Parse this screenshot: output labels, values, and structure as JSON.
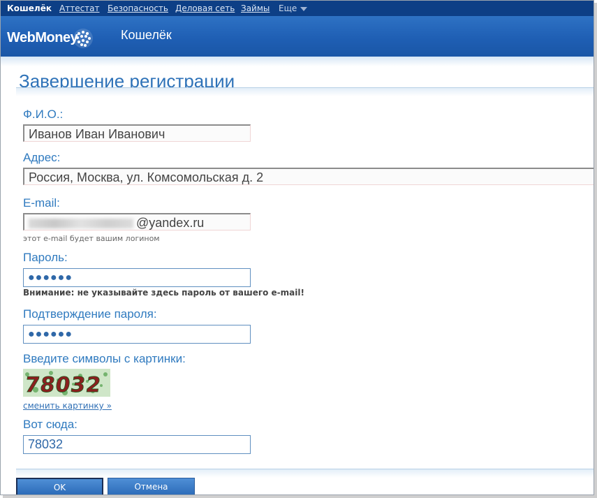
{
  "topnav": {
    "items": [
      "Кошелёк",
      "Аттестат",
      "Безопасность",
      "Деловая сеть",
      "Займы"
    ],
    "more_label": "Еще"
  },
  "header": {
    "logo_text": "WebMoney",
    "title": "Кошелёк"
  },
  "page": {
    "title": "Завершение регистрации"
  },
  "form": {
    "fio": {
      "label": "Ф.И.О.:",
      "value": "Иванов Иван Иванович"
    },
    "address": {
      "label": "Адрес:",
      "value": "Россия, Москва, ул. Комсомольская д. 2"
    },
    "email": {
      "label": "E-mail:",
      "value_suffix": "@yandex.ru",
      "hint": "этот e-mail будет вашим логином"
    },
    "password": {
      "label": "Пароль:",
      "value": "●●●●●●",
      "warning": "Внимание: не указывайте здесь пароль от вашего e-mail!"
    },
    "password_confirm": {
      "label": "Подтверждение пароля:",
      "value": "●●●●●●"
    },
    "captcha": {
      "label": "Введите символы с картинки:",
      "image_text": "78032",
      "change_link": "сменить картинку »"
    },
    "captcha_answer": {
      "label": "Вот сюда:",
      "value": "78032"
    }
  },
  "buttons": {
    "ok": "OK",
    "cancel": "Отмена"
  },
  "colors": {
    "nav_bg": "#0d3f86",
    "header_bg": "#1f5fb4",
    "label": "#2f7abf",
    "button": "#2c6bb8"
  }
}
